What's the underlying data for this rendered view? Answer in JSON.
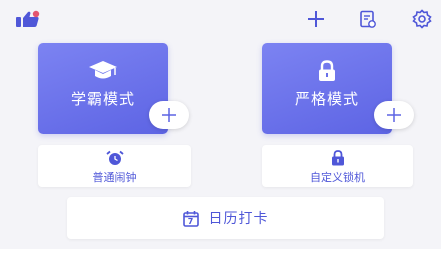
{
  "toolbar": {
    "like_icon": "thumbs-up-icon",
    "add_icon": "plus-icon",
    "notes_icon": "notes-icon",
    "settings_icon": "gear-icon"
  },
  "modes": [
    {
      "label": "学霸模式",
      "icon": "graduation-cap-icon",
      "action_icon": "plus-icon"
    },
    {
      "label": "严格模式",
      "icon": "lock-icon",
      "action_icon": "plus-icon"
    }
  ],
  "quick": [
    {
      "label": "普通闹钟",
      "icon": "alarm-clock-icon"
    },
    {
      "label": "自定义锁机",
      "icon": "lock-icon"
    }
  ],
  "calendar": {
    "label": "日历打卡",
    "icon": "calendar-icon",
    "day": "7"
  },
  "colors": {
    "accent": "#5d64e4",
    "accent_light": "#7c83f2",
    "like": "#e2556f",
    "background": "#f4f4f8"
  }
}
